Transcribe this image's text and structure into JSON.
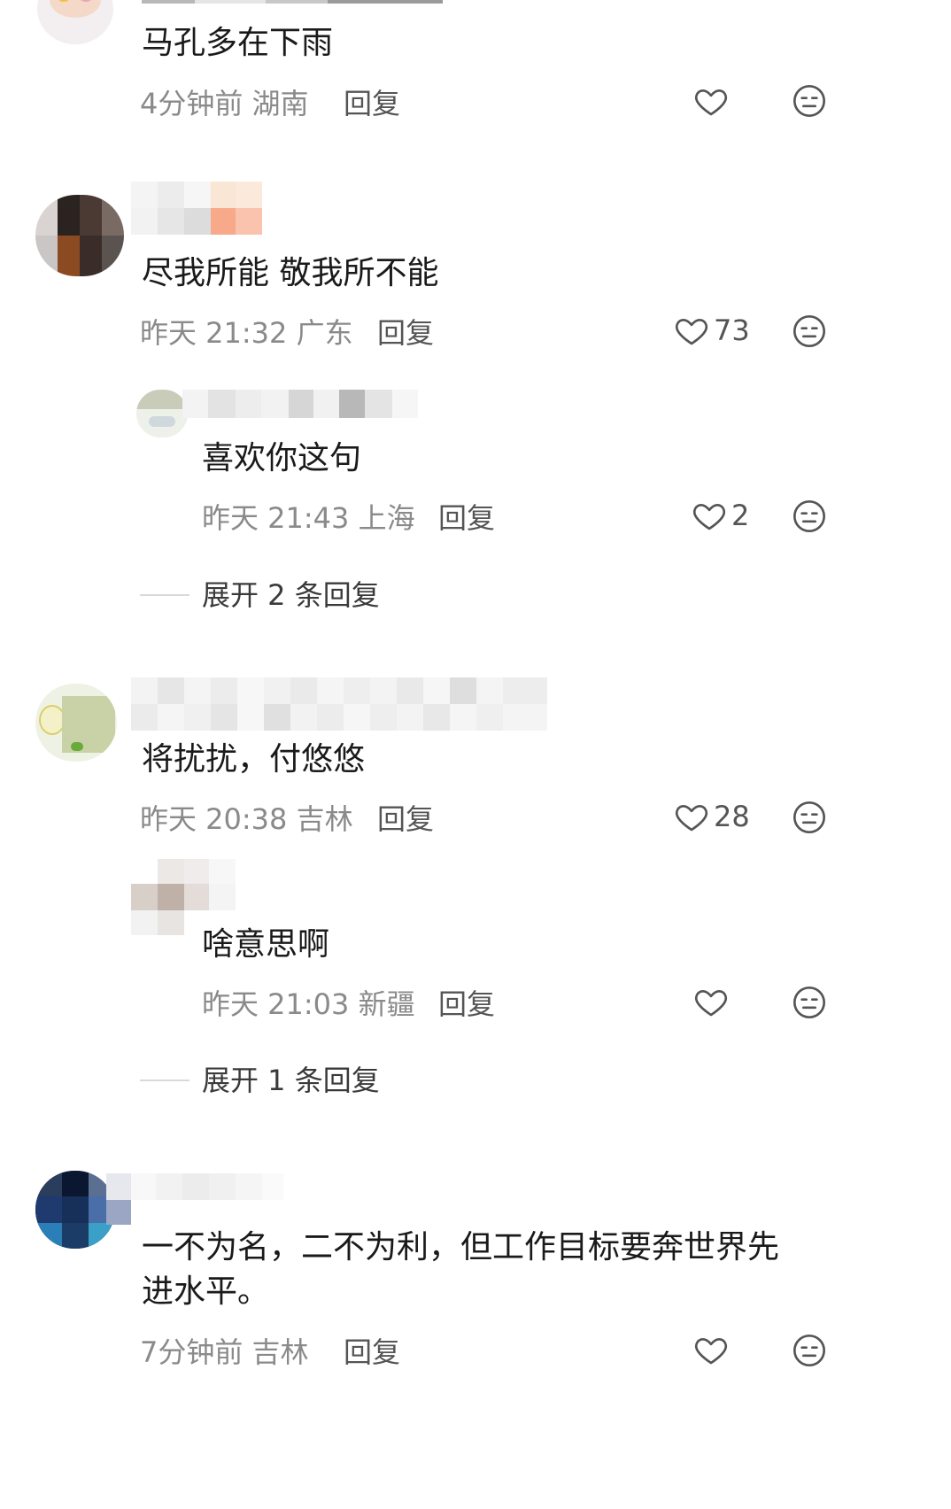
{
  "comments": [
    {
      "text": "马孔多在下雨",
      "time": "4分钟前",
      "location": "湖南",
      "reply_label": "回复",
      "likes": ""
    },
    {
      "text": "尽我所能 敬我所不能",
      "time": "昨天 21:32",
      "location": "广东",
      "reply_label": "回复",
      "likes": "73",
      "replies": [
        {
          "text": "喜欢你这句",
          "time": "昨天 21:43",
          "location": "上海",
          "reply_label": "回复",
          "likes": "2"
        }
      ],
      "expand_label": "展开 2 条回复"
    },
    {
      "text": "将扰扰，付悠悠",
      "time": "昨天 20:38",
      "location": "吉林",
      "reply_label": "回复",
      "likes": "28",
      "replies": [
        {
          "text": "啥意思啊",
          "time": "昨天 21:03",
          "location": "新疆",
          "reply_label": "回复",
          "likes": ""
        }
      ],
      "expand_label": "展开 1 条回复"
    },
    {
      "text_line1": "一不为名，二不为利，但工作目标要奔世界先",
      "text_line2": "进水平。",
      "time": "7分钟前",
      "location": "吉林",
      "reply_label": "回复",
      "likes": ""
    }
  ],
  "icons": {
    "like": "heart-outline-icon",
    "react": "meh-face-icon"
  },
  "colors": {
    "text": "#1a1a1a",
    "meta": "#8a8a8a",
    "icon": "#555555"
  }
}
